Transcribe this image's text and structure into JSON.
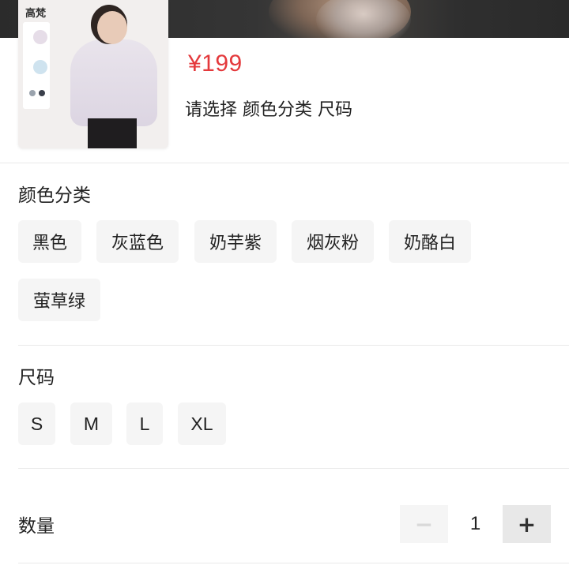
{
  "product": {
    "thumbnail_brand": "高梵",
    "price": "¥199",
    "select_hint": "请选择 颜色分类 尺码"
  },
  "color": {
    "title": "颜色分类",
    "options": [
      "黑色",
      "灰蓝色",
      "奶芋紫",
      "烟灰粉",
      "奶酪白",
      "萤草绿"
    ]
  },
  "size": {
    "title": "尺码",
    "options": [
      "S",
      "M",
      "L",
      "XL"
    ]
  },
  "quantity": {
    "label": "数量",
    "value": "1",
    "minus": "−",
    "plus": "+"
  },
  "colors": {
    "price": "#e4393c",
    "chip_bg": "#f5f5f5",
    "divider": "#eaeaea"
  },
  "icons": {
    "minus": "minus-icon",
    "plus": "plus-icon"
  }
}
